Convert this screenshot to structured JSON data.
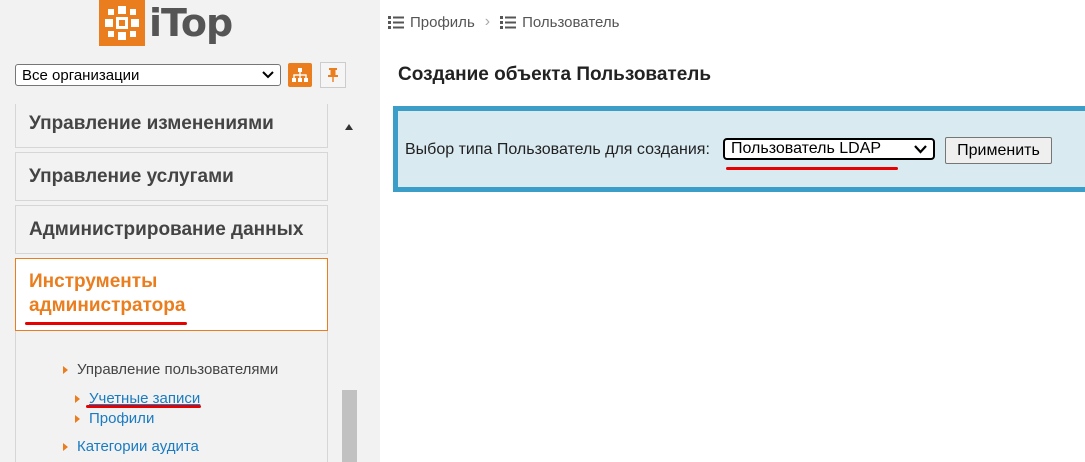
{
  "app": {
    "logo_text": "iTop"
  },
  "org_selector": {
    "value": "Все организации"
  },
  "breadcrumb": {
    "items": [
      "Профиль",
      "Пользователь"
    ]
  },
  "menu": {
    "groups": [
      "Управление изменениями",
      "Управление услугами",
      "Администрирование данных",
      "Инструменты администратора"
    ],
    "submenu": {
      "users": "Управление пользователями",
      "accounts": "Учетные записи",
      "profiles": "Профили",
      "audit": "Категории аудита"
    }
  },
  "main": {
    "title": "Создание объекта Пользователь",
    "form_label": "Выбор типа Пользователь для создания:",
    "type_select_value": "Пользователь LDAP",
    "apply_label": "Применить"
  },
  "colors": {
    "accent": "#ea7d1e",
    "link": "#1a7bc1",
    "form_border": "#3a9ec9",
    "annotation": "#e60000"
  }
}
